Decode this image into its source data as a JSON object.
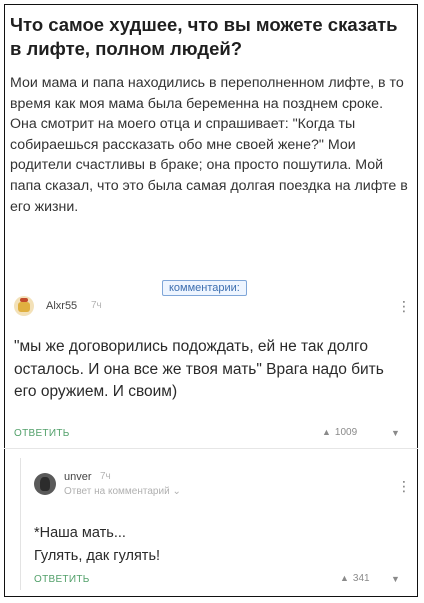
{
  "post": {
    "title": "Что самое худшее, что вы можете сказать в лифте, полном людей?",
    "body": "Мои мама и папа находились в переполненном лифте, в то время как моя мама была беременна на позднем сроке. Она смотрит на моего отца и спрашивает: \"Когда ты собираешься рассказать обо мне своей жене?\" Мои родители счастливы в браке; она просто пошутила. Мой папа сказал, что это была самая долгая поездка на лифте в его жизни.",
    "sticker": "комментарии:"
  },
  "comments": [
    {
      "author": "Alxr55",
      "time": "7ч",
      "text": "\"мы же договорились подождать, ей не так долго осталось. И она все же твоя мать\" Врага надо бить его оружием. И своим)",
      "reply_label": "ОТВЕТИТЬ",
      "votes": "1009",
      "avatar_icon": "cat-avatar-icon"
    },
    {
      "author": "unver",
      "time": "7ч",
      "reply_to": "Ответ на комментарий",
      "text_lines": [
        "*Наша мать...",
        "Гулять, дак гулять!"
      ],
      "reply_label": "ОТВЕТИТЬ",
      "votes": "341",
      "avatar_icon": "user-avatar-icon"
    }
  ],
  "icons": {
    "upvote": "▲",
    "downvote": "▼",
    "more": "⋮",
    "chevron": "⌄"
  },
  "colors": {
    "reply": "#52a06a",
    "sticker_border": "#7fa6d8"
  }
}
